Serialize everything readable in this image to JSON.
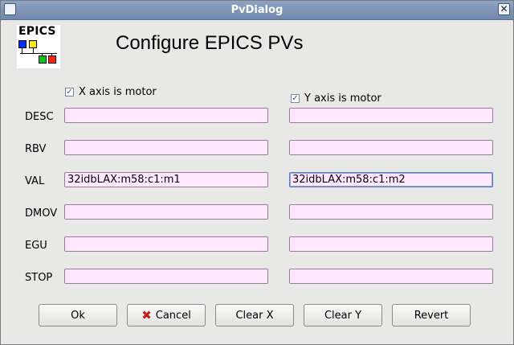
{
  "window": {
    "title": "PvDialog",
    "close_glyph": "✕"
  },
  "header": {
    "logo_text": "EPICS",
    "heading": "Configure EPICS PVs"
  },
  "checkboxes": {
    "x_axis_label": "X axis is motor",
    "x_axis_checked": true,
    "y_axis_label": "Y axis is motor",
    "y_axis_checked": true,
    "check_glyph": "✓"
  },
  "rows": [
    {
      "label": "DESC",
      "x_value": "",
      "y_value": ""
    },
    {
      "label": "RBV",
      "x_value": "",
      "y_value": ""
    },
    {
      "label": "VAL",
      "x_value": "32idbLAX:m58:c1:m1",
      "y_value": "32idbLAX:m58:c1:m2"
    },
    {
      "label": "DMOV",
      "x_value": "",
      "y_value": ""
    },
    {
      "label": "EGU",
      "x_value": "",
      "y_value": ""
    },
    {
      "label": "STOP",
      "x_value": "",
      "y_value": ""
    }
  ],
  "buttons": {
    "ok": "Ok",
    "cancel": "Cancel",
    "clear_x": "Clear X",
    "clear_y": "Clear Y",
    "revert": "Revert"
  },
  "colors": {
    "titlebar": "#7a90b6",
    "field_bg": "#ffe8ff",
    "focus": "#5a7ab8"
  }
}
